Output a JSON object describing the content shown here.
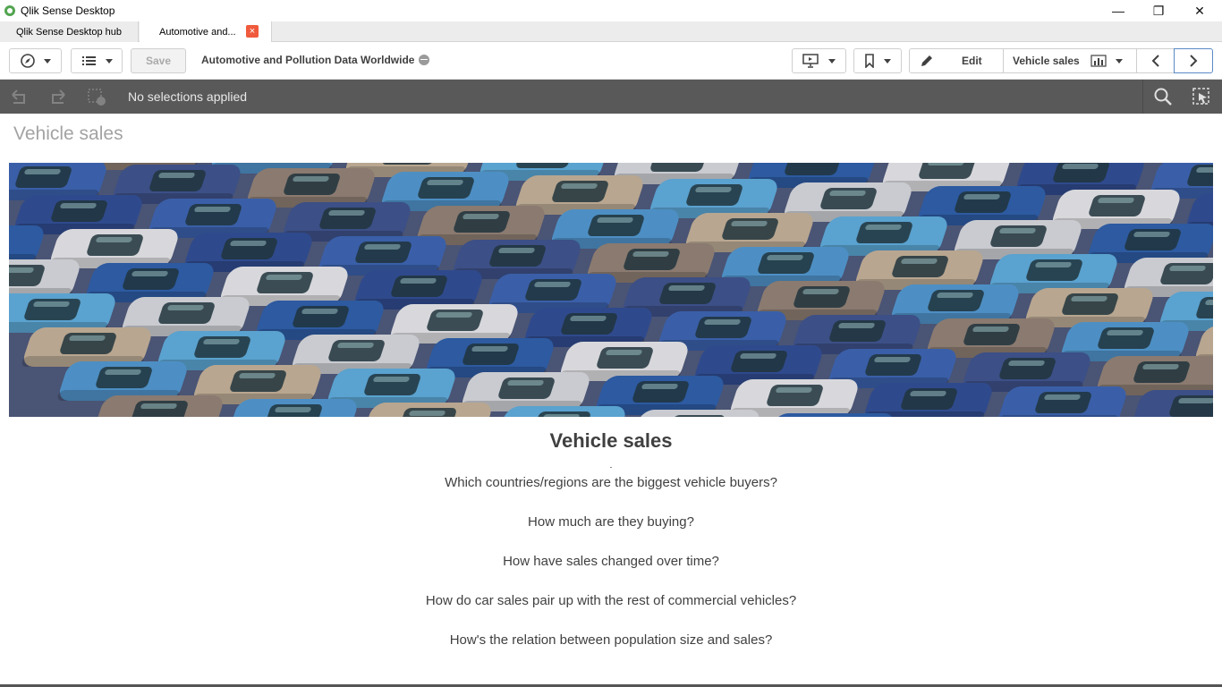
{
  "window": {
    "title": "Qlik Sense Desktop",
    "minimize_glyph": "—",
    "restore_glyph": "❐",
    "close_glyph": "✕"
  },
  "tabs": [
    {
      "label": "Qlik Sense Desktop hub"
    },
    {
      "label": "Automotive and..."
    }
  ],
  "toolbar": {
    "save_label": "Save",
    "app_name": "Automotive and Pollution Data Worldwide",
    "edit_label": "Edit",
    "sheet_label": "Vehicle sales"
  },
  "selections": {
    "status_text": "No selections applied"
  },
  "sheet": {
    "title": "Vehicle sales",
    "heading": "Vehicle sales",
    "questions": [
      "Which countries/regions are the biggest vehicle buyers?",
      "How much are they buying?",
      "How have sales changed over time?",
      "How do car sales pair up with the rest of commercial vehicles?",
      "How's the relation between population size and sales?"
    ]
  },
  "colors": {
    "accent_green": "#52a550",
    "close_tab": "#f05a3c",
    "selection_bar": "#595959"
  }
}
